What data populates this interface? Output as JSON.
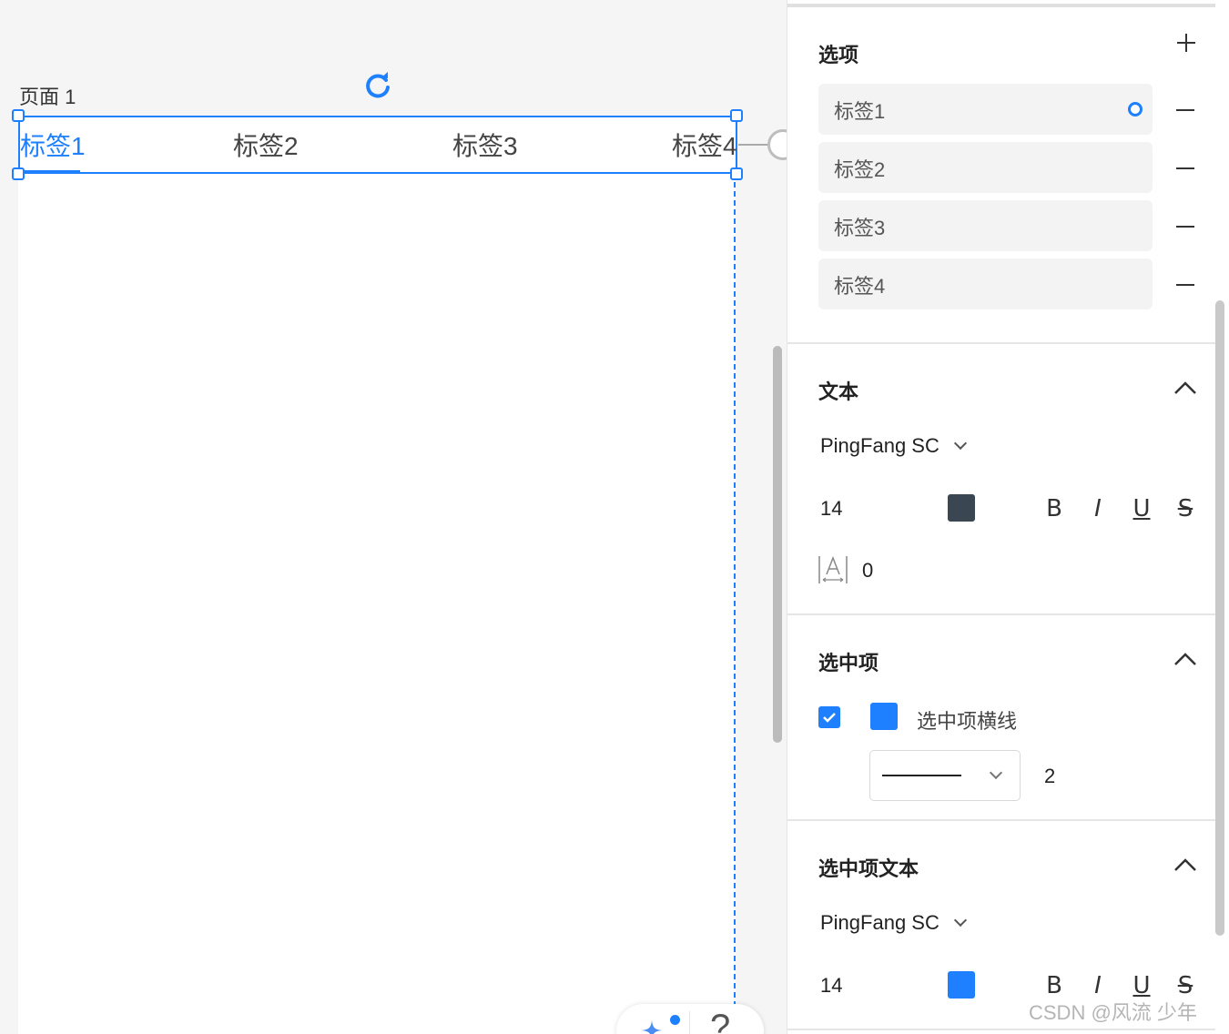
{
  "canvas": {
    "page_label": "页面 1",
    "tabs": [
      "标签1",
      "标签2",
      "标签3",
      "标签4"
    ],
    "selected_tab_index": 0
  },
  "panel": {
    "options": {
      "title": "选项",
      "items": [
        "标签1",
        "标签2",
        "标签3",
        "标签4"
      ]
    },
    "text": {
      "title": "文本",
      "font_family": "PingFang SC",
      "font_size": "14",
      "color": "#3a4651",
      "letter_spacing": "0",
      "style_buttons": [
        "B",
        "I",
        "U",
        "S"
      ]
    },
    "selected_item": {
      "title": "选中项",
      "underline_checked": true,
      "underline_color": "#1e80ff",
      "underline_label": "选中项横线",
      "line_width": "2"
    },
    "selected_item_text": {
      "title": "选中项文本",
      "font_family": "PingFang SC",
      "font_size": "14",
      "color": "#1e80ff",
      "style_buttons": [
        "B",
        "I",
        "U",
        "S"
      ]
    }
  },
  "watermark": "CSDN @风流 少年",
  "colors": {
    "accent": "#1e80ff"
  }
}
